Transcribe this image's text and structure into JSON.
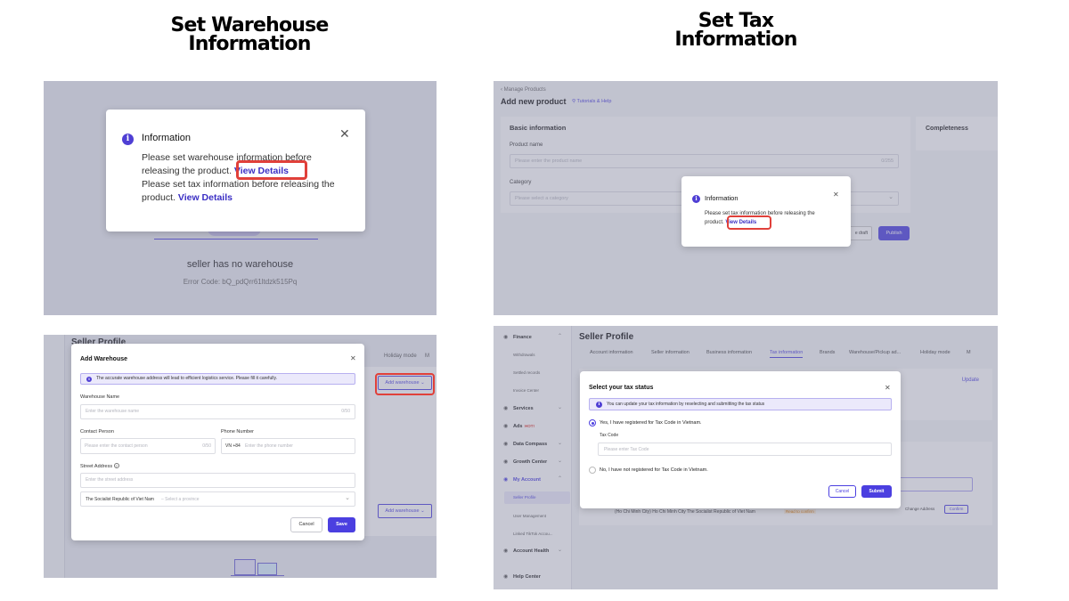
{
  "titles": {
    "left": [
      "Set Warehouse",
      "Information"
    ],
    "right": [
      "Set Tax",
      "Information"
    ]
  },
  "panel1": {
    "modal_title": "Information",
    "line1": "Please set warehouse information before",
    "line2": "releasing the product.",
    "link1": "View Details",
    "line3": "Please set tax information before releasing the",
    "line4": "product.",
    "link2": "View Details",
    "bg_heading": "seller has no warehouse",
    "bg_error": "Error Code: bQ_pdQrr61ltdzk515Pq"
  },
  "panel2": {
    "bg_page_title": "Seller Profile",
    "bg_tab_holiday": "Holiday mode",
    "bg_tab_more": "M",
    "bg_add_button": "Add warehouse",
    "bg_add_button2": "Add warehouse",
    "modal_title": "Add Warehouse",
    "banner": "The accurate warehouse address will lead to efficient logistics service. Please fill it carefully.",
    "warehouse_name_label": "Warehouse Name",
    "warehouse_name_placeholder": "Enter the warehouse name",
    "warehouse_name_count": "0/50",
    "contact_label": "Contact Person",
    "contact_placeholder": "Please enter the contact person",
    "contact_count": "0/50",
    "phone_label": "Phone Number",
    "phone_prefix": "VN +84",
    "phone_placeholder": "Enter the phone number",
    "street_label": "Street Address",
    "street_placeholder": "Enter the street address",
    "country_value": "The Socialist Republic of Viet Nam",
    "province_placeholder": "Select a province",
    "cancel": "Cancel",
    "save": "Save"
  },
  "panel3": {
    "breadcrumb": "Manage Products",
    "page_title": "Add new product",
    "help_link": "Tutorials & Help",
    "section_title": "Basic information",
    "product_name_label": "Product name",
    "product_name_placeholder": "Please enter the product name",
    "product_name_count": "0/255",
    "category_label": "Category",
    "category_placeholder": "Please select a category",
    "completeness": "Completeness",
    "save_draft": "e draft",
    "publish": "Publish",
    "modal_title": "Information",
    "modal_line1": "Please set tax information before releasing the",
    "modal_line2": "product.",
    "modal_link": "View Details"
  },
  "panel4": {
    "sidebar": [
      {
        "label": "Finance",
        "level": "section"
      },
      {
        "label": "Withdrawals",
        "level": "sub"
      },
      {
        "label": "Settled records",
        "level": "sub"
      },
      {
        "label": "Invoice Center",
        "level": "sub"
      },
      {
        "label": "Services",
        "level": "section"
      },
      {
        "label": "Ads",
        "level": "section",
        "badge": "HOT!"
      },
      {
        "label": "Data Compass",
        "level": "section"
      },
      {
        "label": "Growth Center",
        "level": "section"
      },
      {
        "label": "My Account",
        "level": "section",
        "active": true
      },
      {
        "label": "Seller Profile",
        "level": "sub",
        "active": true
      },
      {
        "label": "User Management",
        "level": "sub"
      },
      {
        "label": "Linked TikTok Accou...",
        "level": "sub"
      },
      {
        "label": "Account Health",
        "level": "section"
      },
      {
        "label": "Help Center",
        "level": "section"
      }
    ],
    "page_title": "Seller Profile",
    "tabs": [
      "Account information",
      "Seller information",
      "Business information",
      "Tax information",
      "Brands",
      "Warehouse/Pickup ad...",
      "Holiday mode",
      "M"
    ],
    "active_tab": "Tax information",
    "update_link": "Update",
    "address_text": "(Ho Chi Minh City) Ho Chi Minh City The Socialist Republic of Viet Nam",
    "address_badge": "Read to confirm",
    "change_address": "Change Address",
    "confirm": "Confirm",
    "modal_title": "Select your tax status",
    "banner": "You can update your tax information by reselecting and submitting the tax status",
    "option_yes": "Yes, I have registered for Tax Code in Vietnam.",
    "tax_code_label": "Tax Code",
    "tax_code_placeholder": "Please enter Tax Code",
    "option_no": "No, I have not registered for Tax Code in Vietnam.",
    "cancel": "Cancel",
    "submit": "Submit"
  }
}
